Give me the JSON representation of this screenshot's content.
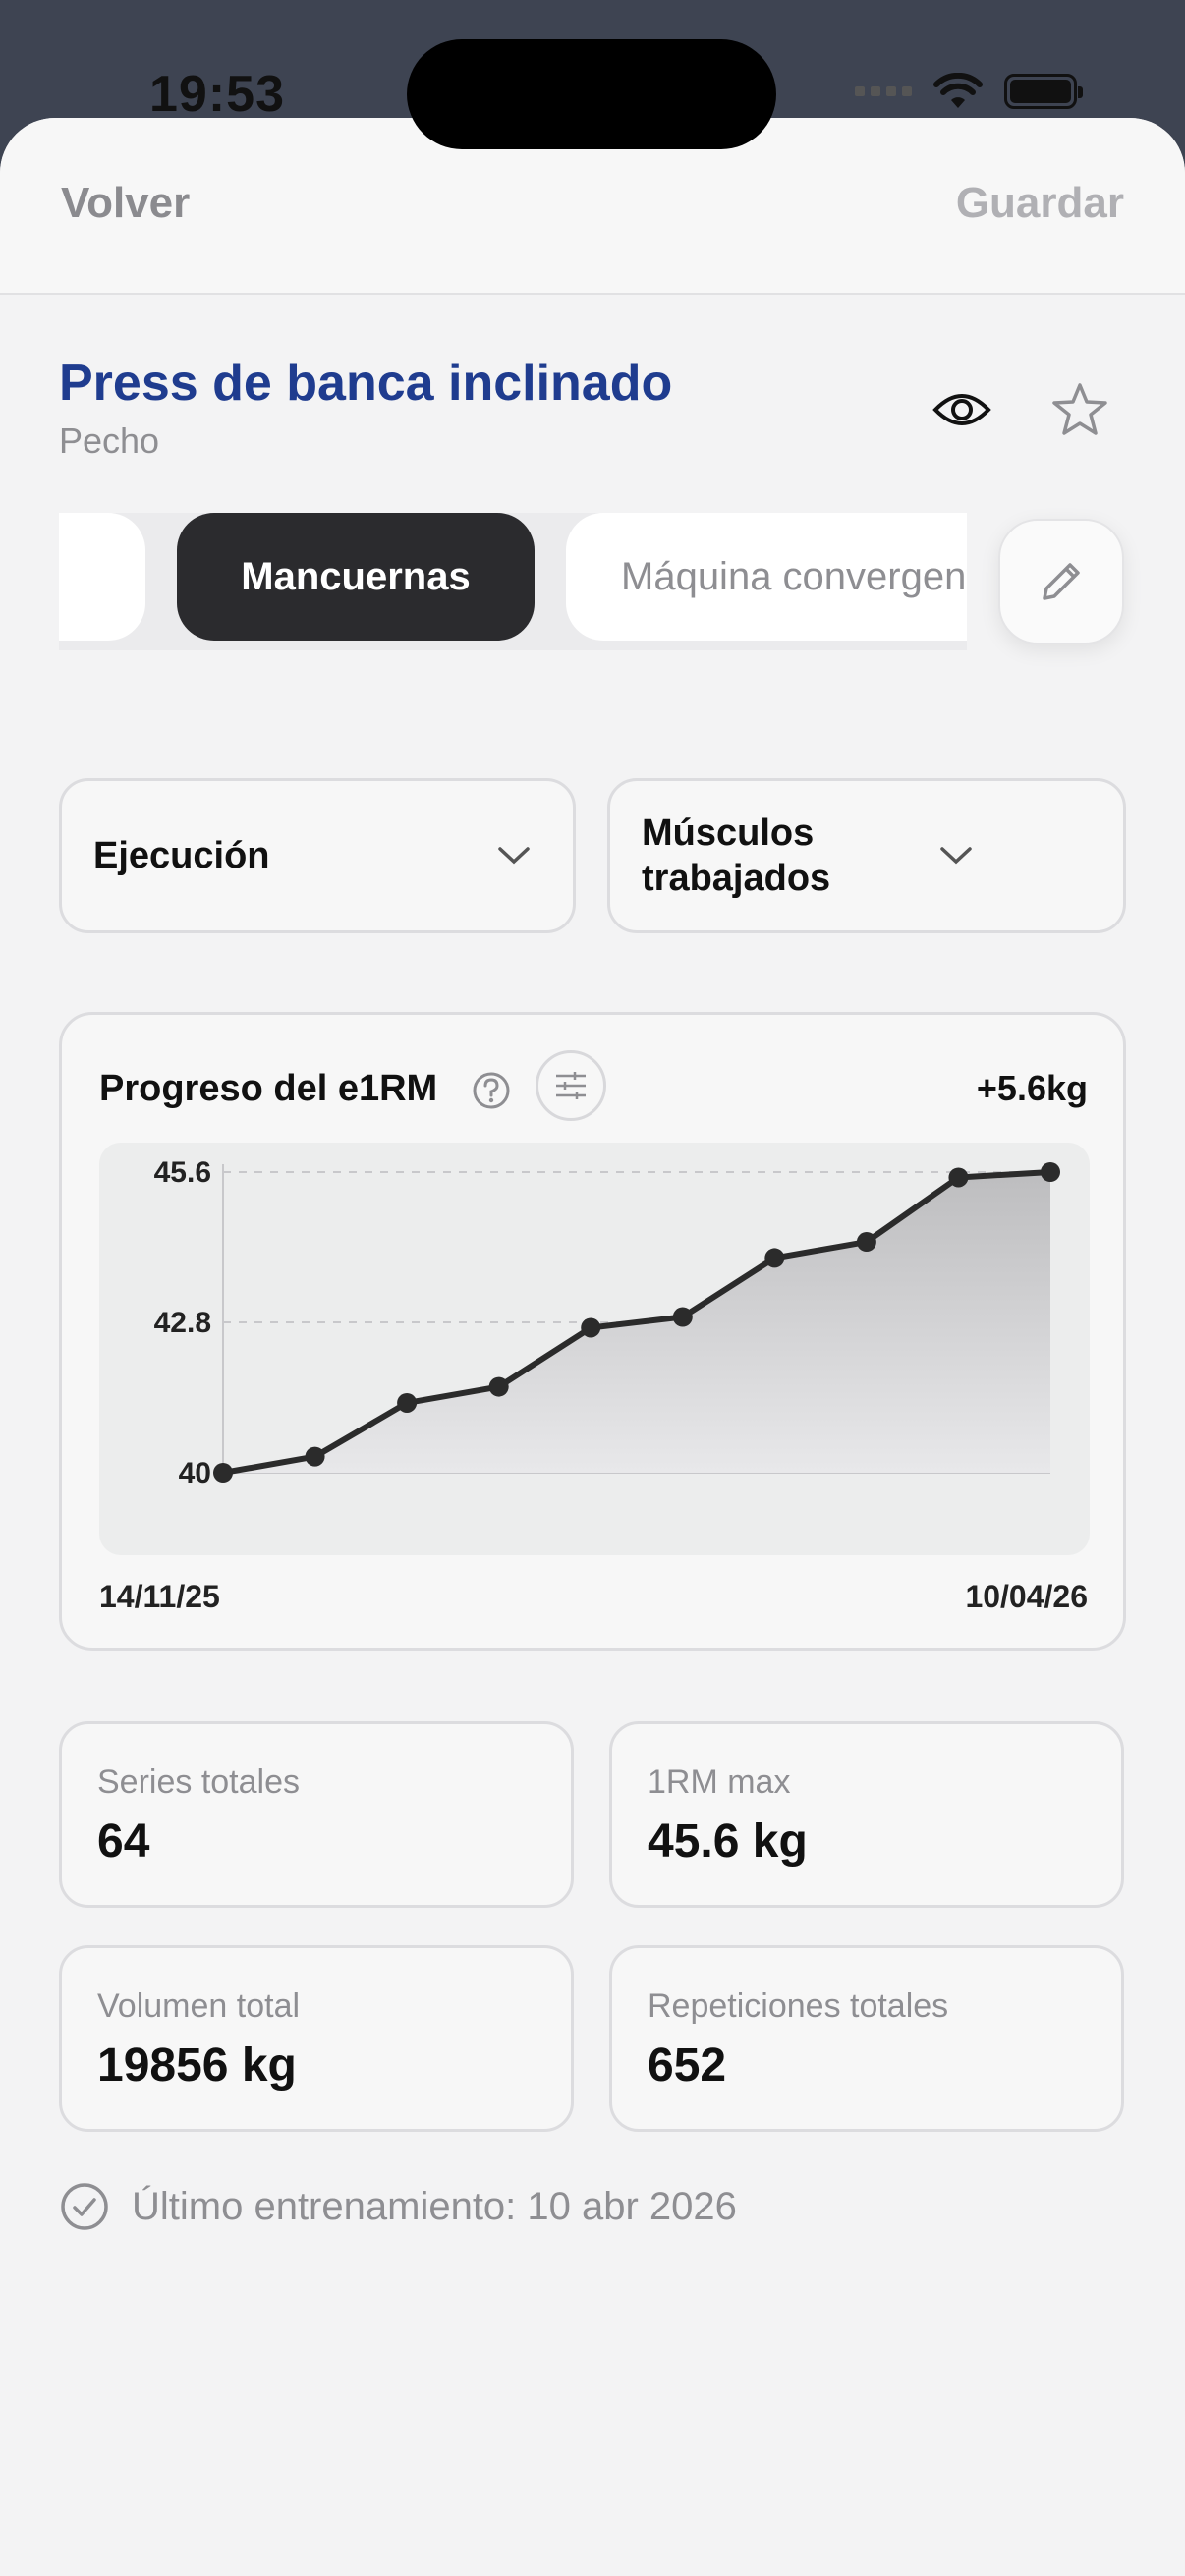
{
  "status": {
    "time": "19:53"
  },
  "nav": {
    "back_label": "Volver",
    "save_label": "Guardar"
  },
  "exercise": {
    "title": "Press de banca inclinado",
    "category": "Pecho"
  },
  "variants": {
    "active": "Mancuernas",
    "next": "Máquina convergente"
  },
  "dropdowns": {
    "execution": "Ejecución",
    "muscles": "Músculos trabajados"
  },
  "chart_data": {
    "type": "line",
    "title": "Progreso del e1RM",
    "delta_label": "+5.6kg",
    "x_start_label": "14/11/25",
    "x_end_label": "10/04/26",
    "y_ticks": [
      "45.6",
      "42.8",
      "40"
    ],
    "ylim": [
      40,
      45.6
    ],
    "values": [
      40.0,
      40.3,
      41.3,
      41.6,
      42.7,
      42.9,
      44.0,
      44.3,
      45.5,
      45.6
    ],
    "grid": true,
    "area_fill": true
  },
  "stats": [
    {
      "label": "Series totales",
      "value": "64"
    },
    {
      "label": "1RM max",
      "value": "45.6 kg"
    },
    {
      "label": "Volumen total",
      "value": "19856 kg"
    },
    {
      "label": "Repeticiones totales",
      "value": "652"
    }
  ],
  "last_training": "Último entrenamiento: 10 abr 2026",
  "colors": {
    "title": "#1f3c8f",
    "active_chip": "#2b2b2e",
    "line": "#2b2b2b"
  }
}
